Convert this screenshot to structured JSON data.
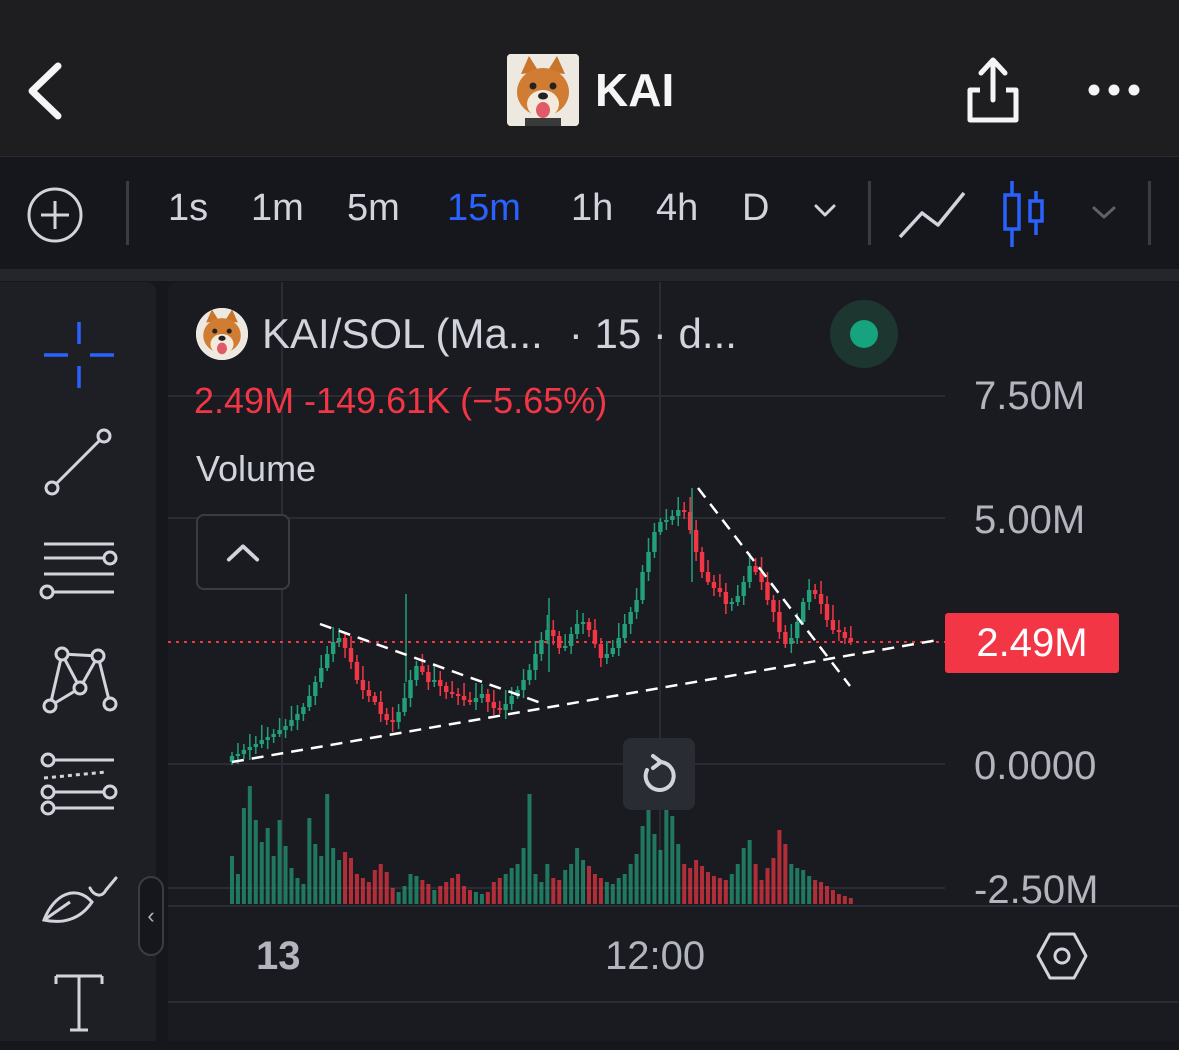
{
  "header": {
    "title": "KAI",
    "avatar_icon": "shiba-dog-avatar",
    "back_icon": "chevron-left-icon",
    "share_icon": "share-icon",
    "more_icon": "more-horizontal-icon"
  },
  "toolbar": {
    "add_icon": "plus-circle-icon",
    "timeframes": [
      "1s",
      "1m",
      "5m",
      "15m",
      "1h",
      "4h",
      "D"
    ],
    "active_timeframe": "15m",
    "chart_types": [
      "line-chart-icon",
      "candlestick-icon"
    ],
    "active_chart_type": "candlestick-icon"
  },
  "sidebar": {
    "tools": [
      "crosshair-icon",
      "trend-line-icon",
      "horizontal-lines-icon",
      "pattern-icon",
      "fib-icon",
      "brush-icon",
      "text-icon"
    ]
  },
  "legend": {
    "symbol": "KAI/SOL (Ma...",
    "interval": "· 15 · d...",
    "ohlc": "2.49M  -149.61K (−5.65%)",
    "volume_label": "Volume",
    "status": "market-open"
  },
  "axis": {
    "y_labels": [
      "7.50M",
      "5.00M",
      "0.0000",
      "-2.50M"
    ],
    "current_price": "2.49M",
    "x_labels": [
      "13",
      "12:00"
    ]
  },
  "colors": {
    "up": "#22a07a",
    "down": "#f23645",
    "accent": "#2962ff",
    "background": "#16171c"
  },
  "chart_data": {
    "type": "candlestick",
    "title": "KAI/SOL",
    "interval": "15",
    "ylim": [
      -2500000,
      8000000
    ],
    "y_ticks": [
      7500000,
      5000000,
      0,
      -2500000
    ],
    "last_price": 2490000,
    "change": -149610,
    "change_pct": -5.65,
    "annotations": [
      "descending trend line",
      "ascending trend line",
      "descending trend line 2"
    ]
  }
}
